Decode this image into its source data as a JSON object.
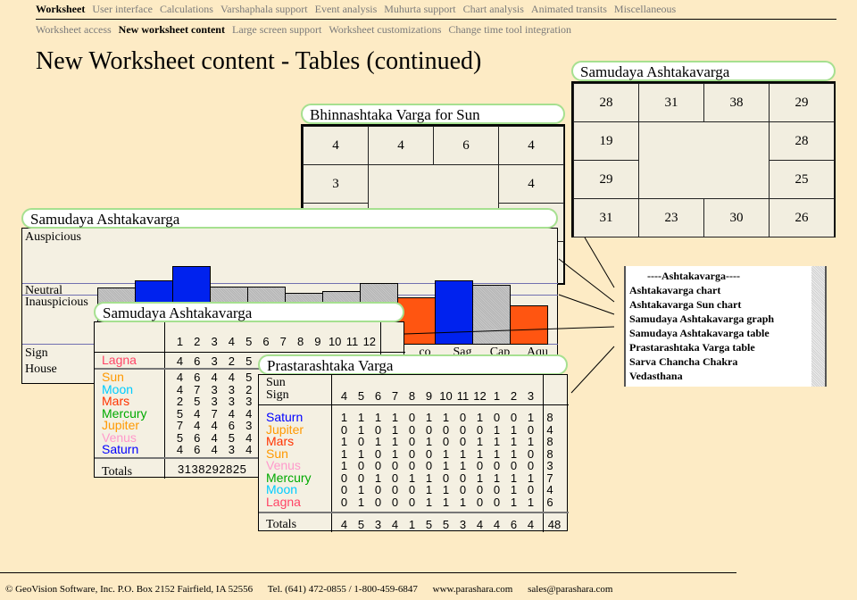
{
  "nav_primary": [
    {
      "label": "Worksheet",
      "active": true
    },
    {
      "label": "User interface"
    },
    {
      "label": "Calculations"
    },
    {
      "label": "Varshaphala support"
    },
    {
      "label": "Event analysis"
    },
    {
      "label": "Muhurta support"
    },
    {
      "label": "Chart analysis"
    },
    {
      "label": "Animated transits"
    },
    {
      "label": "Miscellaneous"
    }
  ],
  "nav_secondary": [
    {
      "label": "Worksheet access"
    },
    {
      "label": "New worksheet content",
      "active": true
    },
    {
      "label": "Large screen support"
    },
    {
      "label": "Worksheet customizations"
    },
    {
      "label": "Change time tool integration"
    }
  ],
  "page_title": "New Worksheet content - Tables (continued)",
  "samudaya_chakra": {
    "title": "Samudaya Ashtakavarga",
    "top": [
      "28",
      "31",
      "38",
      "29"
    ],
    "left": [
      "19",
      "29"
    ],
    "right": [
      "28",
      "25"
    ],
    "bottom": [
      "31",
      "23",
      "30",
      "26"
    ]
  },
  "bhinnashtaka": {
    "title": "Bhinnashtaka Varga for Sun",
    "top": [
      "4",
      "4",
      "6",
      "4"
    ],
    "left": [
      "3"
    ],
    "right": [
      "4"
    ]
  },
  "graph": {
    "title": "Samudaya Ashtakavarga",
    "labels": {
      "auspicious": "Auspicious",
      "neutral": "Neutral",
      "inauspicious": "Inauspicious",
      "sign": "Sign",
      "house": "House"
    },
    "sign_labels": [
      "co",
      "Sag",
      "Cap",
      "Aqu"
    ],
    "bar_colors": {
      "blue": "#0022ee",
      "orange": "#ff5511",
      "gray": "#bbbbbb"
    }
  },
  "samudaya_table": {
    "title": "Samudaya Ashtakavarga",
    "houses": [
      "1",
      "2",
      "3",
      "4",
      "5",
      "6",
      "7",
      "8",
      "9",
      "10",
      "11",
      "12"
    ],
    "lagna": {
      "name": "Lagna",
      "values": [
        "4",
        "6",
        "3",
        "2",
        "5"
      ]
    },
    "planets": [
      {
        "name": "Sun",
        "color": "#ff9900",
        "values": [
          "4",
          "6",
          "4",
          "4",
          "5"
        ]
      },
      {
        "name": "Moon",
        "color": "#00ccff",
        "values": [
          "4",
          "7",
          "3",
          "3",
          "2"
        ]
      },
      {
        "name": "Mars",
        "color": "#ff3300",
        "values": [
          "2",
          "5",
          "3",
          "3",
          "3"
        ]
      },
      {
        "name": "Mercury",
        "color": "#00aa00",
        "values": [
          "5",
          "4",
          "7",
          "4",
          "4"
        ]
      },
      {
        "name": "Jupiter",
        "color": "#ff9900",
        "values": [
          "7",
          "4",
          "4",
          "6",
          "3"
        ]
      },
      {
        "name": "Venus",
        "color": "#ff99cc",
        "values": [
          "5",
          "6",
          "4",
          "5",
          "4"
        ]
      },
      {
        "name": "Saturn",
        "color": "#0000ff",
        "values": [
          "4",
          "6",
          "4",
          "3",
          "4"
        ]
      }
    ],
    "totals_label": "Totals",
    "totals": "3138292825"
  },
  "prastarashtaka": {
    "title": "Prastarashtaka Varga",
    "header_label_1": "Sun",
    "header_label_2": "Sign",
    "signs": [
      "4",
      "5",
      "6",
      "7",
      "8",
      "9",
      "10",
      "11",
      "12",
      "1",
      "2",
      "3"
    ],
    "rows": [
      {
        "name": "Saturn",
        "color": "#0000ff",
        "values": [
          "1",
          "1",
          "1",
          "1",
          "0",
          "1",
          "1",
          "0",
          "1",
          "0",
          "0",
          "1"
        ],
        "total": "8"
      },
      {
        "name": "Jupiter",
        "color": "#ff9900",
        "values": [
          "0",
          "1",
          "0",
          "1",
          "0",
          "0",
          "0",
          "0",
          "0",
          "1",
          "1",
          "0"
        ],
        "total": "4"
      },
      {
        "name": "Mars",
        "color": "#ff3300",
        "values": [
          "1",
          "0",
          "1",
          "1",
          "0",
          "1",
          "0",
          "0",
          "1",
          "1",
          "1",
          "1"
        ],
        "total": "8"
      },
      {
        "name": "Sun",
        "color": "#ff9900",
        "values": [
          "1",
          "1",
          "0",
          "1",
          "0",
          "0",
          "1",
          "1",
          "1",
          "1",
          "1",
          "0"
        ],
        "total": "8"
      },
      {
        "name": "Venus",
        "color": "#ff99cc",
        "values": [
          "1",
          "0",
          "0",
          "0",
          "0",
          "0",
          "1",
          "1",
          "0",
          "0",
          "0",
          "0"
        ],
        "total": "3"
      },
      {
        "name": "Mercury",
        "color": "#00aa00",
        "values": [
          "0",
          "0",
          "1",
          "0",
          "1",
          "1",
          "0",
          "0",
          "1",
          "1",
          "1",
          "1"
        ],
        "total": "7"
      },
      {
        "name": "Moon",
        "color": "#00ccff",
        "values": [
          "0",
          "1",
          "0",
          "0",
          "0",
          "1",
          "1",
          "0",
          "0",
          "0",
          "1",
          "0"
        ],
        "total": "4"
      },
      {
        "name": "Lagna",
        "color": "#ff4466",
        "values": [
          "0",
          "1",
          "0",
          "0",
          "0",
          "1",
          "1",
          "1",
          "0",
          "0",
          "1",
          "1"
        ],
        "total": "6"
      }
    ],
    "totals_label": "Totals",
    "totals": [
      "4",
      "5",
      "3",
      "4",
      "1",
      "5",
      "5",
      "3",
      "4",
      "4",
      "6",
      "4"
    ],
    "grand_total": "48"
  },
  "menu": {
    "header": "----Ashtakavarga----",
    "items": [
      "Ashtakavarga chart",
      "Ashtakavarga Sun chart",
      "Samudaya Ashtakavarga graph",
      "Samudaya Ashtakavarga table",
      "Prastarashtaka Varga table",
      "Sarva Chancha Chakra",
      "Vedasthana"
    ]
  },
  "footer": {
    "company": "© GeoVision Software, Inc. P.O. Box 2152 Fairfield, IA 52556",
    "phone": "Tel. (641) 472-0855 / 1-800-459-6847",
    "website": "www.parashara.com",
    "email": "sales@parashara.com"
  }
}
